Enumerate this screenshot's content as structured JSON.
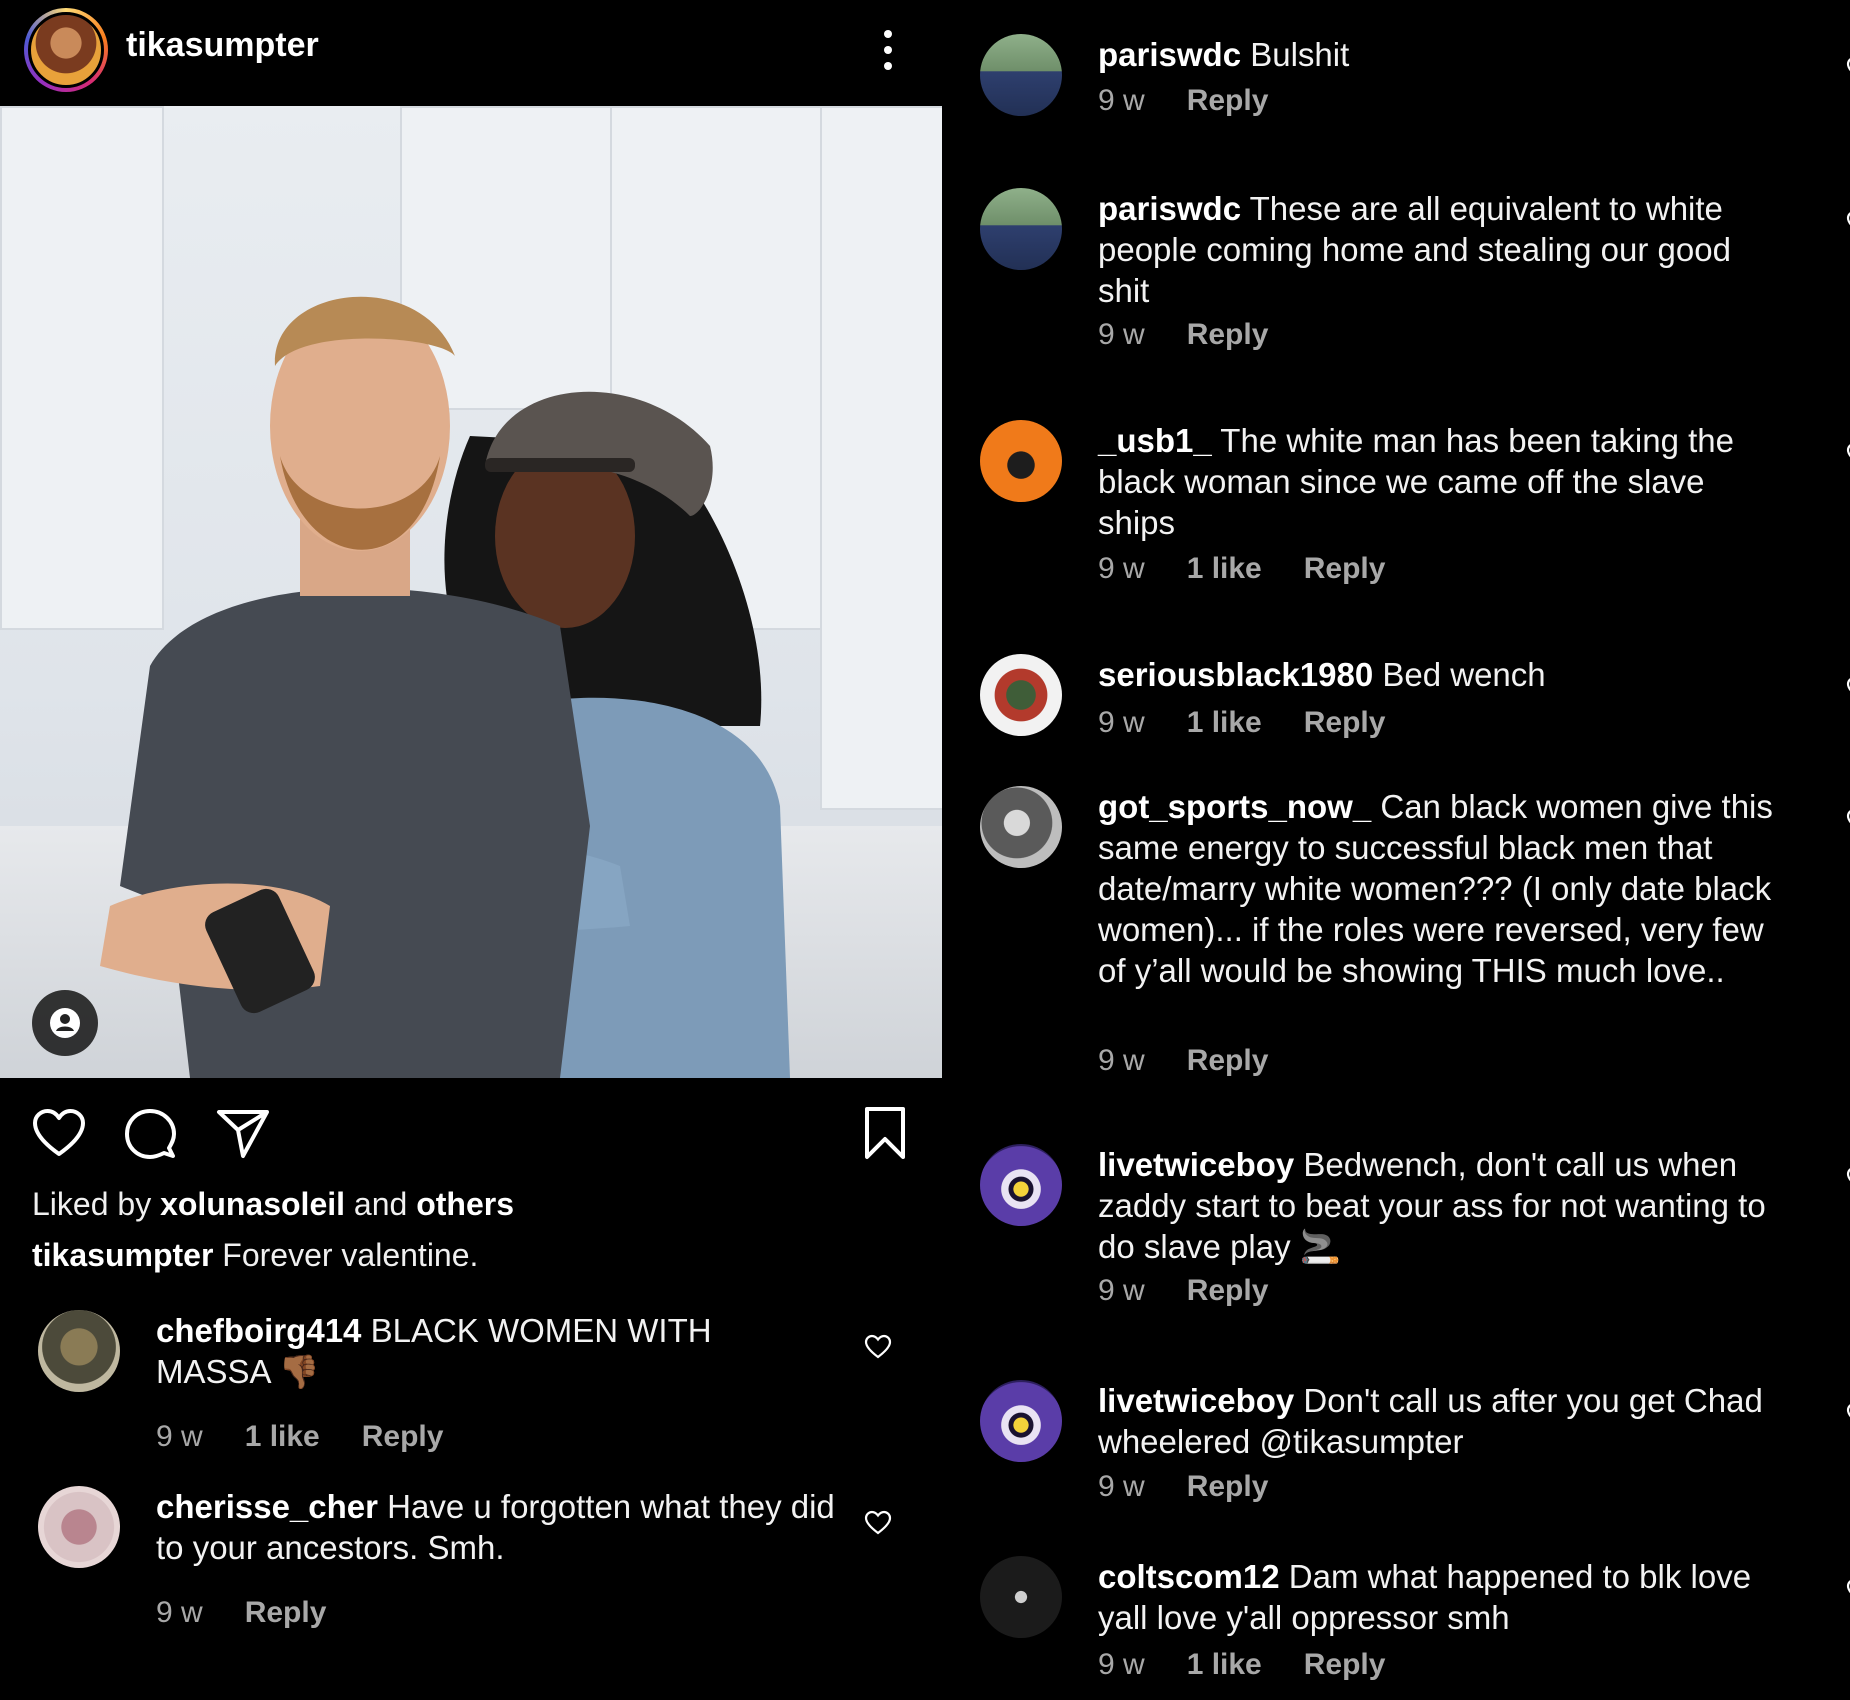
{
  "post": {
    "username": "tikasumpter",
    "liked_by_prefix": "Liked by ",
    "liked_by_user": "xolunasoleil",
    "liked_by_middle": " and ",
    "liked_by_suffix": "others",
    "caption_user": "tikasumpter",
    "caption_text": " Forever valentine."
  },
  "icons": {
    "header_more": "more-vertical-icon",
    "user_tag": "user-tag-icon",
    "like": "heart-icon",
    "comment": "comment-icon",
    "share": "send-icon",
    "save": "bookmark-icon",
    "comment_like": "heart-icon"
  },
  "left_comments": [
    {
      "user": "chefboirg414",
      "text": " BLACK WOMEN WITH MASSA 👎🏾",
      "time": "9 w",
      "likes": "1 like",
      "reply": "Reply"
    },
    {
      "user": "cherisse_cher",
      "text": " Have u forgotten what they did to your ancestors. Smh.",
      "time": "9 w",
      "likes": "",
      "reply": "Reply"
    }
  ],
  "right_comments": [
    {
      "user": "pariswdc",
      "text": " Bulshit",
      "time": "9 w",
      "likes": "",
      "reply": "Reply"
    },
    {
      "user": "pariswdc",
      "text": " These are all equivalent to white people coming home and stealing our good shit",
      "time": "9 w",
      "likes": "",
      "reply": "Reply"
    },
    {
      "user": "_usb1_",
      "text": " The white man has been taking the black woman since we came off the slave ships",
      "time": "9 w",
      "likes": "1 like",
      "reply": "Reply"
    },
    {
      "user": "seriousblack1980",
      "text": " Bed wench",
      "time": "9 w",
      "likes": "1 like",
      "reply": "Reply"
    },
    {
      "user": "got_sports_now_",
      "text": " Can black women give this same energy to successful black men that date/marry white women??? (I only date black women)... if the roles were reversed, very few of y’all would be showing THIS much love..",
      "time": "9 w",
      "likes": "",
      "reply": "Reply"
    },
    {
      "user": "livetwiceboy",
      "text": " Bedwench, don't call us when zaddy start to beat your ass for not wanting to do slave play 🚬",
      "time": "9 w",
      "likes": "",
      "reply": "Reply"
    },
    {
      "user": "livetwiceboy",
      "text": " Don't call us after you get Chad wheelered @tikasumpter",
      "time": "9 w",
      "likes": "",
      "reply": "Reply"
    },
    {
      "user": "coltscom12",
      "text": " Dam what happened to blk love yall love y'all oppressor smh",
      "time": "9 w",
      "likes": "1 like",
      "reply": "Reply"
    }
  ]
}
